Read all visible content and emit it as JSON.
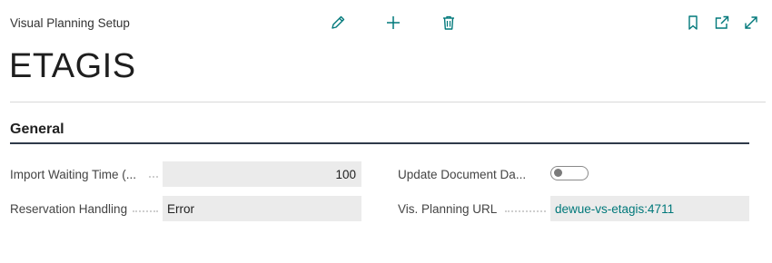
{
  "header": {
    "caption": "Visual Planning Setup",
    "record_title": "ETAGIS"
  },
  "toolbar": {
    "actions": [
      {
        "icon": "pencil-icon",
        "name": "edit"
      },
      {
        "icon": "plus-icon",
        "name": "new"
      },
      {
        "icon": "trash-icon",
        "name": "delete"
      }
    ],
    "window_actions": [
      {
        "icon": "bookmark-icon",
        "name": "bookmark"
      },
      {
        "icon": "open-new-window-icon",
        "name": "open-in-new-window"
      },
      {
        "icon": "expand-icon",
        "name": "expand"
      }
    ]
  },
  "section": {
    "title": "General"
  },
  "fields": {
    "import_waiting_time": {
      "label": "Import Waiting Time (...",
      "value": "100"
    },
    "reservation_handling": {
      "label": "Reservation Handling",
      "value": "Error"
    },
    "update_document_date": {
      "label": "Update Document Da...",
      "value": false
    },
    "vis_planning_url": {
      "label": "Vis. Planning URL",
      "value": "dewue-vs-etagis:4711"
    }
  },
  "colors": {
    "accent": "#00787a",
    "field_background": "#ebebeb",
    "section_underline": "#2f3a4a"
  }
}
